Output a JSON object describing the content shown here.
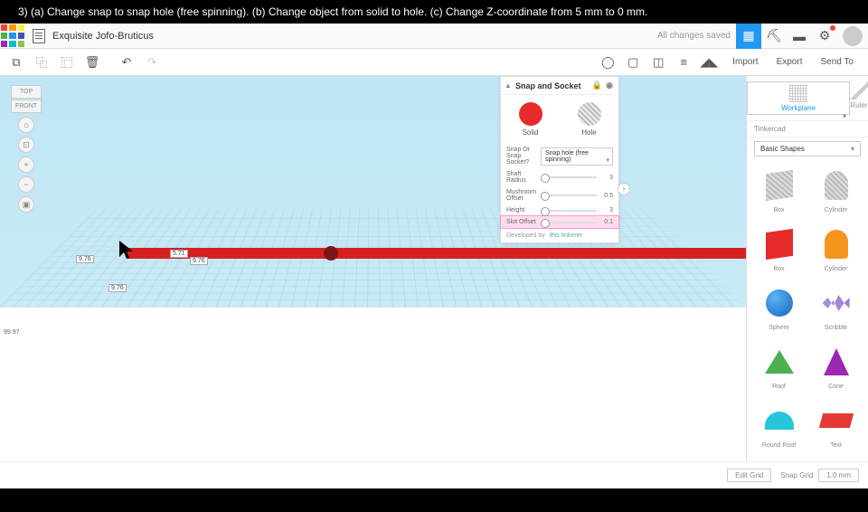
{
  "instruction": "3) (a) Change snap to snap hole (free spinning).  (b) Change object from solid to hole. (c) Change Z-coordinate from 5 mm to  0 mm.",
  "doc_title": "Exquisite Jofo-Bruticus",
  "saved_text": "All changes saved",
  "actions": {
    "import": "Import",
    "export": "Export",
    "send": "Send To"
  },
  "viewcube": {
    "top": "TOP",
    "front": "FRONT"
  },
  "dims": {
    "d1": "9.76",
    "d2": "5.71",
    "d3": "9.76",
    "d4": "9.76",
    "axis": "99.97"
  },
  "inspector": {
    "title": "Snap and Socket",
    "solid": "Solid",
    "hole": "Hole",
    "props": {
      "snap": {
        "label": "Snap Or Snap Socket?",
        "value": "Snap hole (free spinning)"
      },
      "shaft": {
        "label": "Shaft Radius",
        "value": "3"
      },
      "mush": {
        "label": "Mushroom Offset",
        "value": "0.5"
      },
      "height": {
        "label": "Height",
        "value": "3"
      },
      "slot": {
        "label": "Slot Offset",
        "value": "0.1"
      }
    },
    "dev": "Developed by",
    "devlink": "this tinkerer"
  },
  "right": {
    "workplane": "Workplane",
    "ruler": "Ruler",
    "section": "Tinkercad",
    "catalog": "Basic Shapes",
    "shapes": {
      "box_h": "Box",
      "cyl_h": "Cylinder",
      "box": "Box",
      "cyl": "Cylinder",
      "sphere": "Sphere",
      "scrib": "Scribble",
      "roof": "Roof",
      "cone": "Cone",
      "rroof": "Round Roof",
      "text": "Text"
    }
  },
  "bottom": {
    "edit": "Edit Grid",
    "snap": "Snap Grid",
    "snapval": "1.0 mm"
  }
}
